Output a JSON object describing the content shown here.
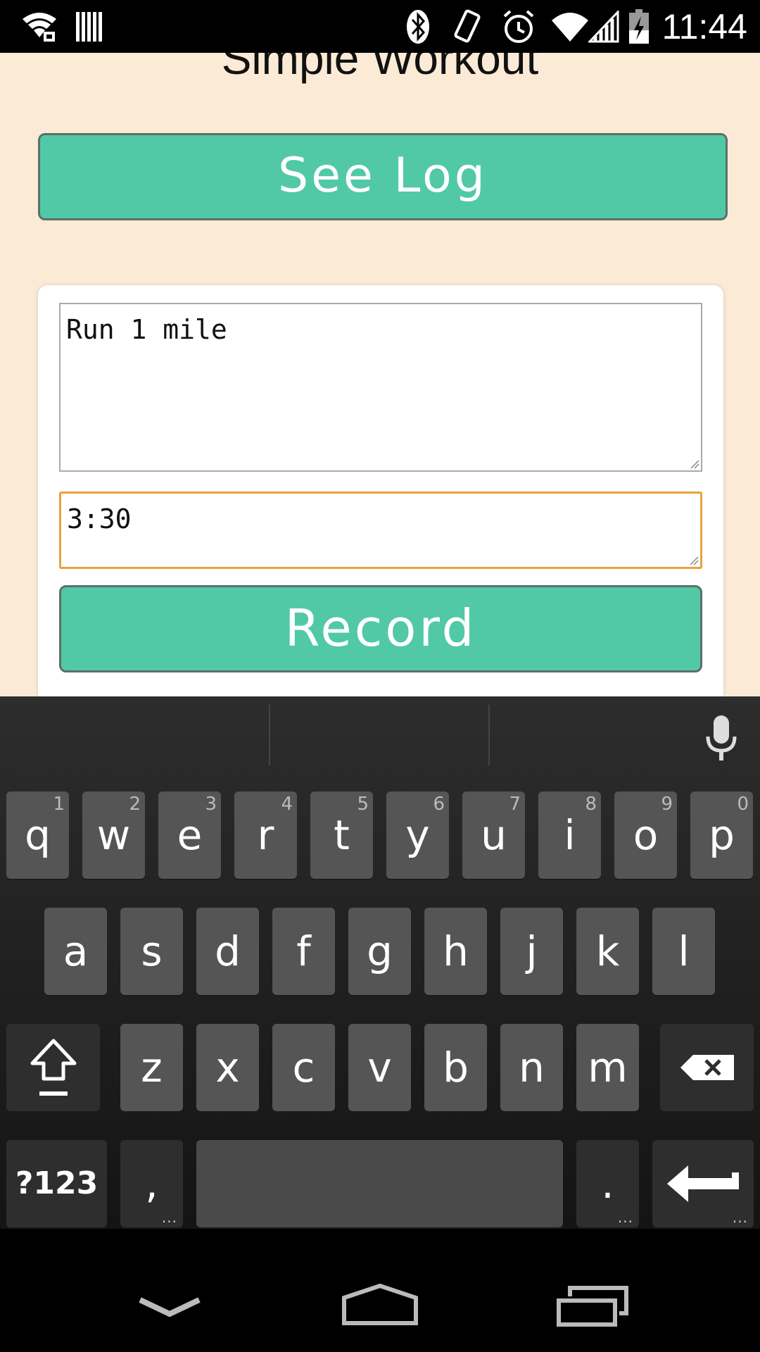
{
  "status_bar": {
    "time": "11:44",
    "icons": [
      "wifi-lock-icon",
      "barcode-icon",
      "bluetooth-icon",
      "vibrate-icon",
      "alarm-icon",
      "wifi-icon",
      "signal-icon",
      "battery-charging-icon"
    ]
  },
  "app": {
    "title": "Simple Workout",
    "see_log_label": "See Log",
    "workout_field_value": "Run 1 mile",
    "time_field_value": "3:30",
    "record_label": "Record"
  },
  "colors": {
    "background": "#fbebd6",
    "button": "#52c9a6",
    "focus_border": "#e7a33a"
  },
  "keyboard": {
    "row1": [
      {
        "key": "q",
        "hint": "1"
      },
      {
        "key": "w",
        "hint": "2"
      },
      {
        "key": "e",
        "hint": "3"
      },
      {
        "key": "r",
        "hint": "4"
      },
      {
        "key": "t",
        "hint": "5"
      },
      {
        "key": "y",
        "hint": "6"
      },
      {
        "key": "u",
        "hint": "7"
      },
      {
        "key": "i",
        "hint": "8"
      },
      {
        "key": "o",
        "hint": "9"
      },
      {
        "key": "p",
        "hint": "0"
      }
    ],
    "row2": [
      "a",
      "s",
      "d",
      "f",
      "g",
      "h",
      "j",
      "k",
      "l"
    ],
    "row3": [
      "z",
      "x",
      "c",
      "v",
      "b",
      "n",
      "m"
    ],
    "symbols_label": "?123",
    "comma": ",",
    "period": ".",
    "icons": [
      "mic-icon",
      "shift-icon",
      "backspace-icon",
      "enter-icon"
    ]
  },
  "nav_bar": {
    "icons": [
      "back-chevron-icon",
      "home-icon",
      "recents-icon"
    ]
  }
}
